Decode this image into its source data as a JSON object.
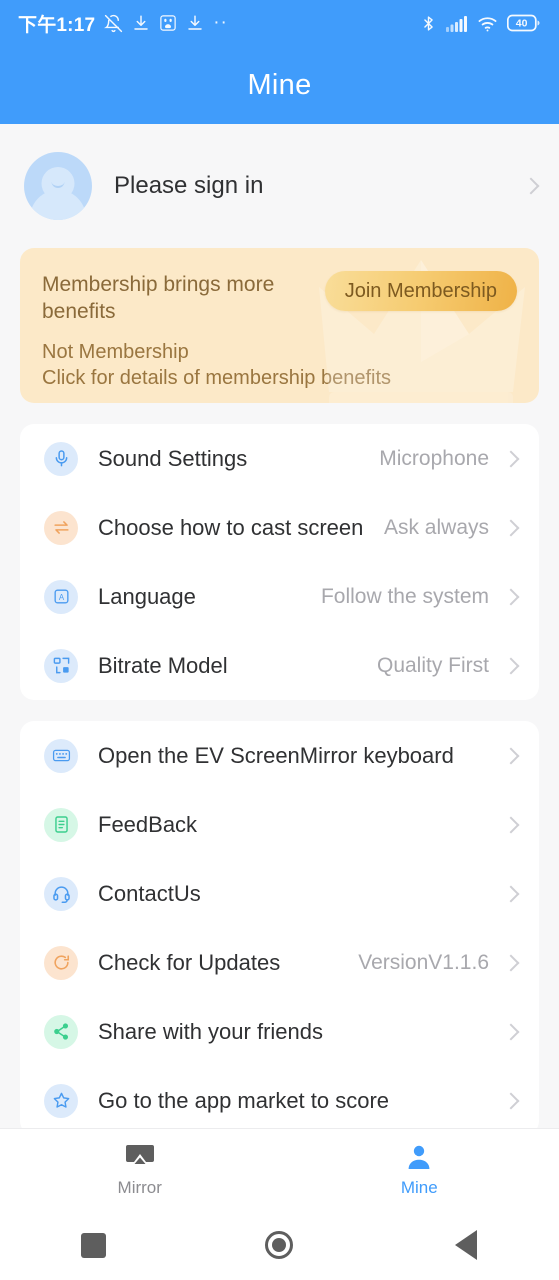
{
  "statusbar": {
    "time": "下午1:17",
    "left_icons": [
      "bell-off-icon",
      "download-icon",
      "baidu-app-icon",
      "download-icon"
    ],
    "more_dots": "··",
    "right_icons": [
      "bluetooth-icon",
      "cellular-signal-icon",
      "wifi-icon",
      "battery-icon"
    ],
    "battery_level": "40"
  },
  "header": {
    "title": "Mine",
    "accent": "#409cfb"
  },
  "account": {
    "label": "Please sign in",
    "avatar": "user-avatar-placeholder"
  },
  "membership": {
    "title": "Membership brings more benefits",
    "status": "Not Membership",
    "details": "Click for details of membership benefits",
    "join_label": "Join Membership",
    "bg": "#fce9c8",
    "button_color": "#efb247"
  },
  "settings_card": {
    "rows": [
      {
        "label": "Sound Settings",
        "value": "Microphone",
        "icon": "microphone-icon",
        "tone": "blue"
      },
      {
        "label": "Choose how to cast screen",
        "value": "Ask always",
        "icon": "swap-arrows-icon",
        "tone": "orange"
      },
      {
        "label": "Language",
        "value": "Follow the system",
        "icon": "language-letter-a-icon",
        "tone": "blue"
      },
      {
        "label": "Bitrate Model",
        "value": "Quality First",
        "icon": "bitrate-grid-icon",
        "tone": "blue"
      }
    ]
  },
  "actions_card": {
    "rows": [
      {
        "label": "Open the EV ScreenMirror keyboard",
        "value": "",
        "icon": "keyboard-icon",
        "tone": "blue"
      },
      {
        "label": "FeedBack",
        "value": "",
        "icon": "document-icon",
        "tone": "green"
      },
      {
        "label": "ContactUs",
        "value": "",
        "icon": "headset-icon",
        "tone": "blue"
      },
      {
        "label": "Check for Updates",
        "value": "VersionV1.1.6",
        "icon": "refresh-icon",
        "tone": "orange"
      },
      {
        "label": "Share with your friends",
        "value": "",
        "icon": "share-nodes-icon",
        "tone": "green"
      },
      {
        "label": "Go to the app market to score",
        "value": "",
        "icon": "star-icon",
        "tone": "blue"
      }
    ]
  },
  "tabbar": {
    "tabs": [
      {
        "label": "Mirror",
        "icon": "cast-mirror-icon",
        "active": false
      },
      {
        "label": "Mine",
        "icon": "person-icon",
        "active": true
      }
    ]
  },
  "navbar": {
    "buttons": [
      "recents-square-icon",
      "home-circle-icon",
      "back-triangle-icon"
    ]
  }
}
